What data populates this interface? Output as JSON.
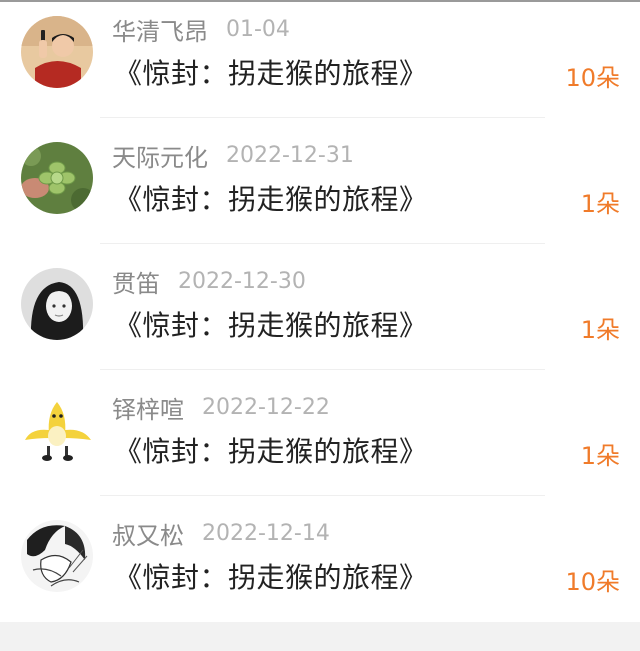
{
  "items": [
    {
      "user": "华清飞昂",
      "date": "01-04",
      "title": "《惊封：拐走猴的旅程》",
      "count": "10朵",
      "avatar_icon": "avatar-person-phone-icon"
    },
    {
      "user": "天际元化",
      "date": "2022-12-31",
      "title": "《惊封：拐走猴的旅程》",
      "count": "1朵",
      "avatar_icon": "avatar-succulent-plant-icon"
    },
    {
      "user": "贯笛",
      "date": "2022-12-30",
      "title": "《惊封：拐走猴的旅程》",
      "count": "1朵",
      "avatar_icon": "avatar-girl-portrait-icon"
    },
    {
      "user": "铎梓喧",
      "date": "2022-12-22",
      "title": "《惊封：拐走猴的旅程》",
      "count": "1朵",
      "avatar_icon": "avatar-banana-character-icon"
    },
    {
      "user": "叔又松",
      "date": "2022-12-14",
      "title": "《惊封：拐走猴的旅程》",
      "count": "10朵",
      "avatar_icon": "avatar-manga-sketch-icon"
    }
  ],
  "colors": {
    "username": "#8a8a8a",
    "date": "#b3b3b3",
    "title": "#222222",
    "count": "#f07b2a"
  }
}
